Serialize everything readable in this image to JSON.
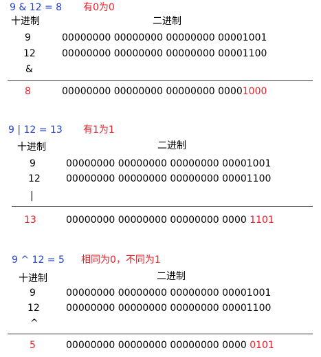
{
  "sections": [
    {
      "title": "9 & 12 = 8",
      "rule": "有0为0",
      "decimal_header": "十进制",
      "binary_header": "二进制",
      "row1_dec": "9",
      "row1_bin": "00000000 00000000 00000000 00001001",
      "row2_dec": "12",
      "row2_bin": "00000000 00000000 00000000 00001100",
      "operator": "&",
      "result_dec": "8",
      "result_bin_prefix": "00000000 00000000 00000000 0000",
      "result_bin_suffix": "1000"
    },
    {
      "title": "9 | 12 = 13",
      "rule": "有1为1",
      "decimal_header": "十进制",
      "binary_header": "二进制",
      "row1_dec": "9",
      "row1_bin": "00000000 00000000 00000000 00001001",
      "row2_dec": "12",
      "row2_bin": "00000000 00000000 00000000 00001100",
      "operator": "|",
      "result_dec": "13",
      "result_bin_prefix": "00000000 00000000 00000000 0000 ",
      "result_bin_suffix": "1101"
    },
    {
      "title": "9 ^ 12 = 5",
      "rule": "相同为0，不同为1",
      "decimal_header": "十进制",
      "binary_header": "二进制",
      "row1_dec": "9",
      "row1_bin": "00000000 00000000 00000000 00001001",
      "row2_dec": "12",
      "row2_bin": "00000000 00000000 00000000 00001100",
      "operator": "^",
      "result_dec": "5",
      "result_bin_prefix": "00000000 00000000 00000000 0000 ",
      "result_bin_suffix": "0101"
    }
  ],
  "colors": {
    "title": "#1f3fd6",
    "accent": "#e8202a",
    "text": "#000000"
  }
}
